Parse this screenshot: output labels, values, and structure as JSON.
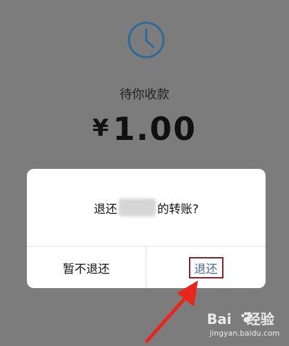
{
  "colors": {
    "background": "#7c7c7c",
    "clock": "#2b6a99",
    "dialog_bg": "#ffffff",
    "confirm_text": "#4c6a9c",
    "highlight_box": "#8b1e1e",
    "arrow": "#e8261b"
  },
  "icons": {
    "status": "clock-icon",
    "annotation": "red-arrow-icon",
    "watermark_logo": "paw-icon"
  },
  "payment": {
    "status_text": "待你收款",
    "currency_symbol": "¥",
    "amount": "1.00"
  },
  "dialog": {
    "message_prefix": "退还",
    "message_suffix": "的转账?",
    "cancel_label": "暂不退还",
    "confirm_label": "退还"
  },
  "watermark": {
    "brand": "Bai",
    "brand_suffix": "经验",
    "url": "jingyan.baidu.com"
  }
}
